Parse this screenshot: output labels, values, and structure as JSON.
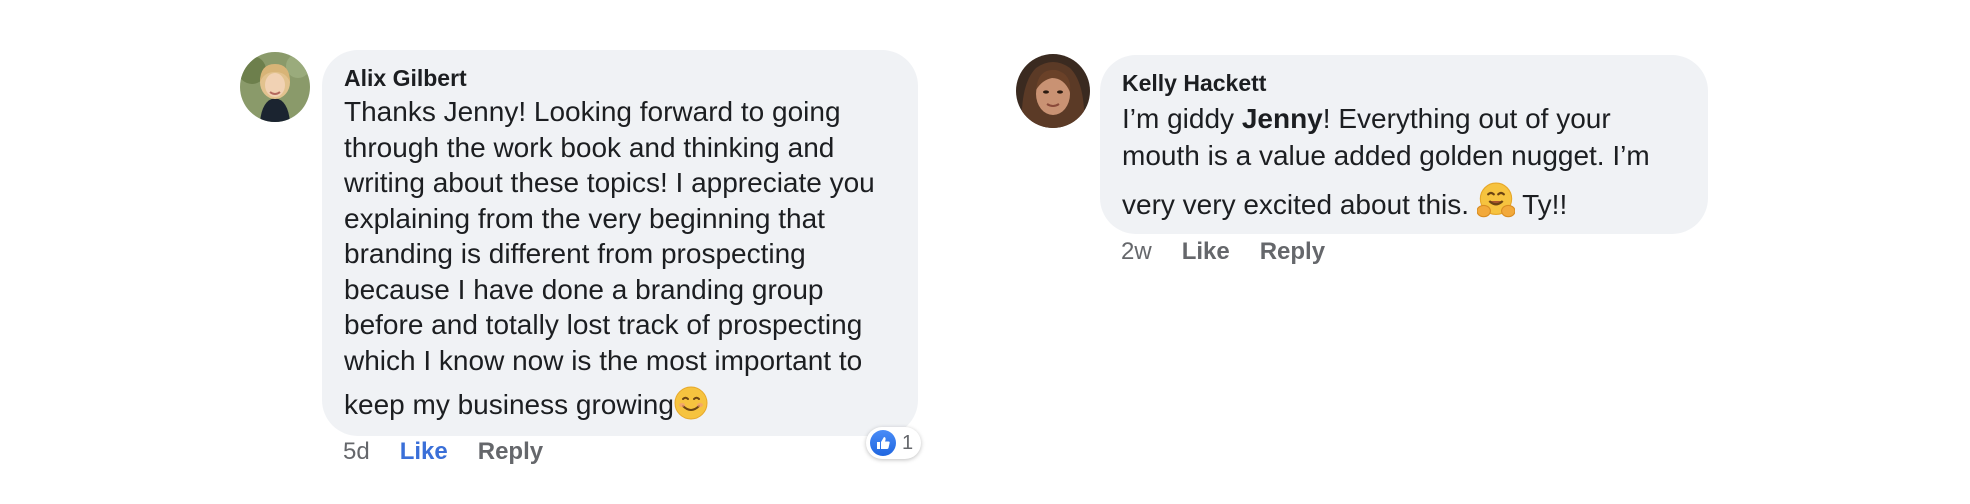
{
  "comments": [
    {
      "author": "Alix Gilbert",
      "lines": [
        "Thanks Jenny! Looking forward to going",
        "through the work book and thinking and",
        "writing about these topics! I appreciate you",
        "explaining from the very beginning that",
        "branding is different from prospecting",
        "because I have done a branding group",
        "before and totally lost track of prospecting",
        "which I know now is the most important to"
      ],
      "last_line": "keep my business growing",
      "last_emoji": "smiling-face-emoji",
      "time": "5d",
      "like_label": "Like",
      "reply_label": "Reply",
      "reaction_count": "1",
      "liked": true,
      "accent": "#3a6fd8"
    },
    {
      "author": "Kelly Hackett",
      "line1_pre": "I’m giddy ",
      "line1_bold": "Jenny",
      "line1_post": "! Everything out of your",
      "line2": "mouth is a value added golden nugget. I’m",
      "line3_pre": "very very excited about this. ",
      "line3_emoji": "hugging-face-emoji",
      "line3_post": " Ty!!",
      "time": "2w",
      "like_label": "Like",
      "reply_label": "Reply",
      "liked": false
    }
  ]
}
